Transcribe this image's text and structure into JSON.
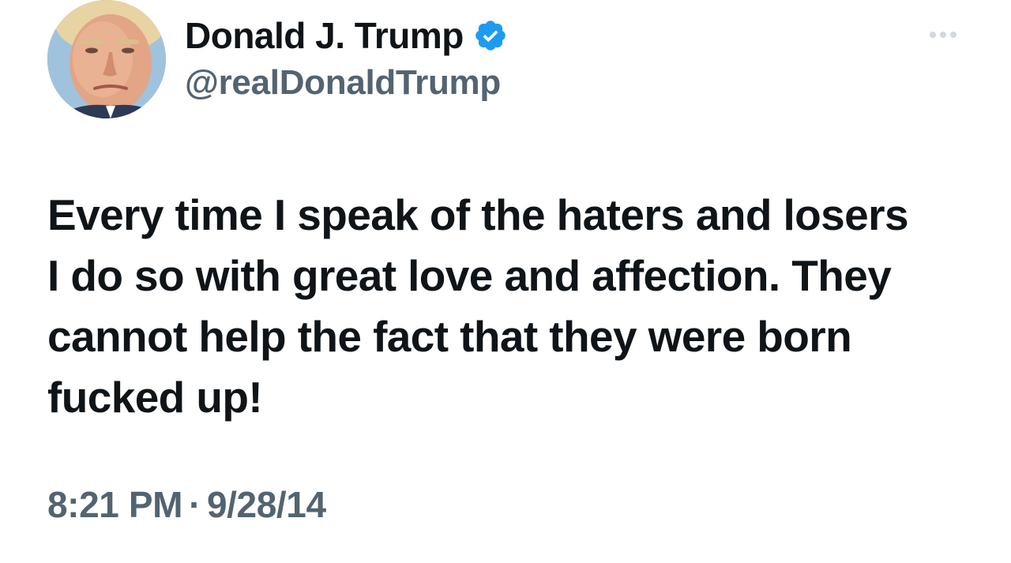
{
  "author": {
    "display_name": "Donald J. Trump",
    "handle": "@realDonaldTrump",
    "verified": true,
    "verified_icon": "verified-badge-icon",
    "verified_color": "#1d9bf0",
    "avatar_icon": "profile-photo"
  },
  "menu": {
    "more_icon": "more-options-icon"
  },
  "tweet": {
    "text": "Every time I speak of the haters and losers\nI do so with great love and affection. They\ncannot help the fact that they were born\nfucked up!"
  },
  "meta": {
    "time": "8:21 PM",
    "separator": "·",
    "date": "9/28/14"
  },
  "colors": {
    "text_primary": "#0f1419",
    "text_secondary": "#536471",
    "background": "#ffffff",
    "more_dots": "#cfd9de"
  }
}
